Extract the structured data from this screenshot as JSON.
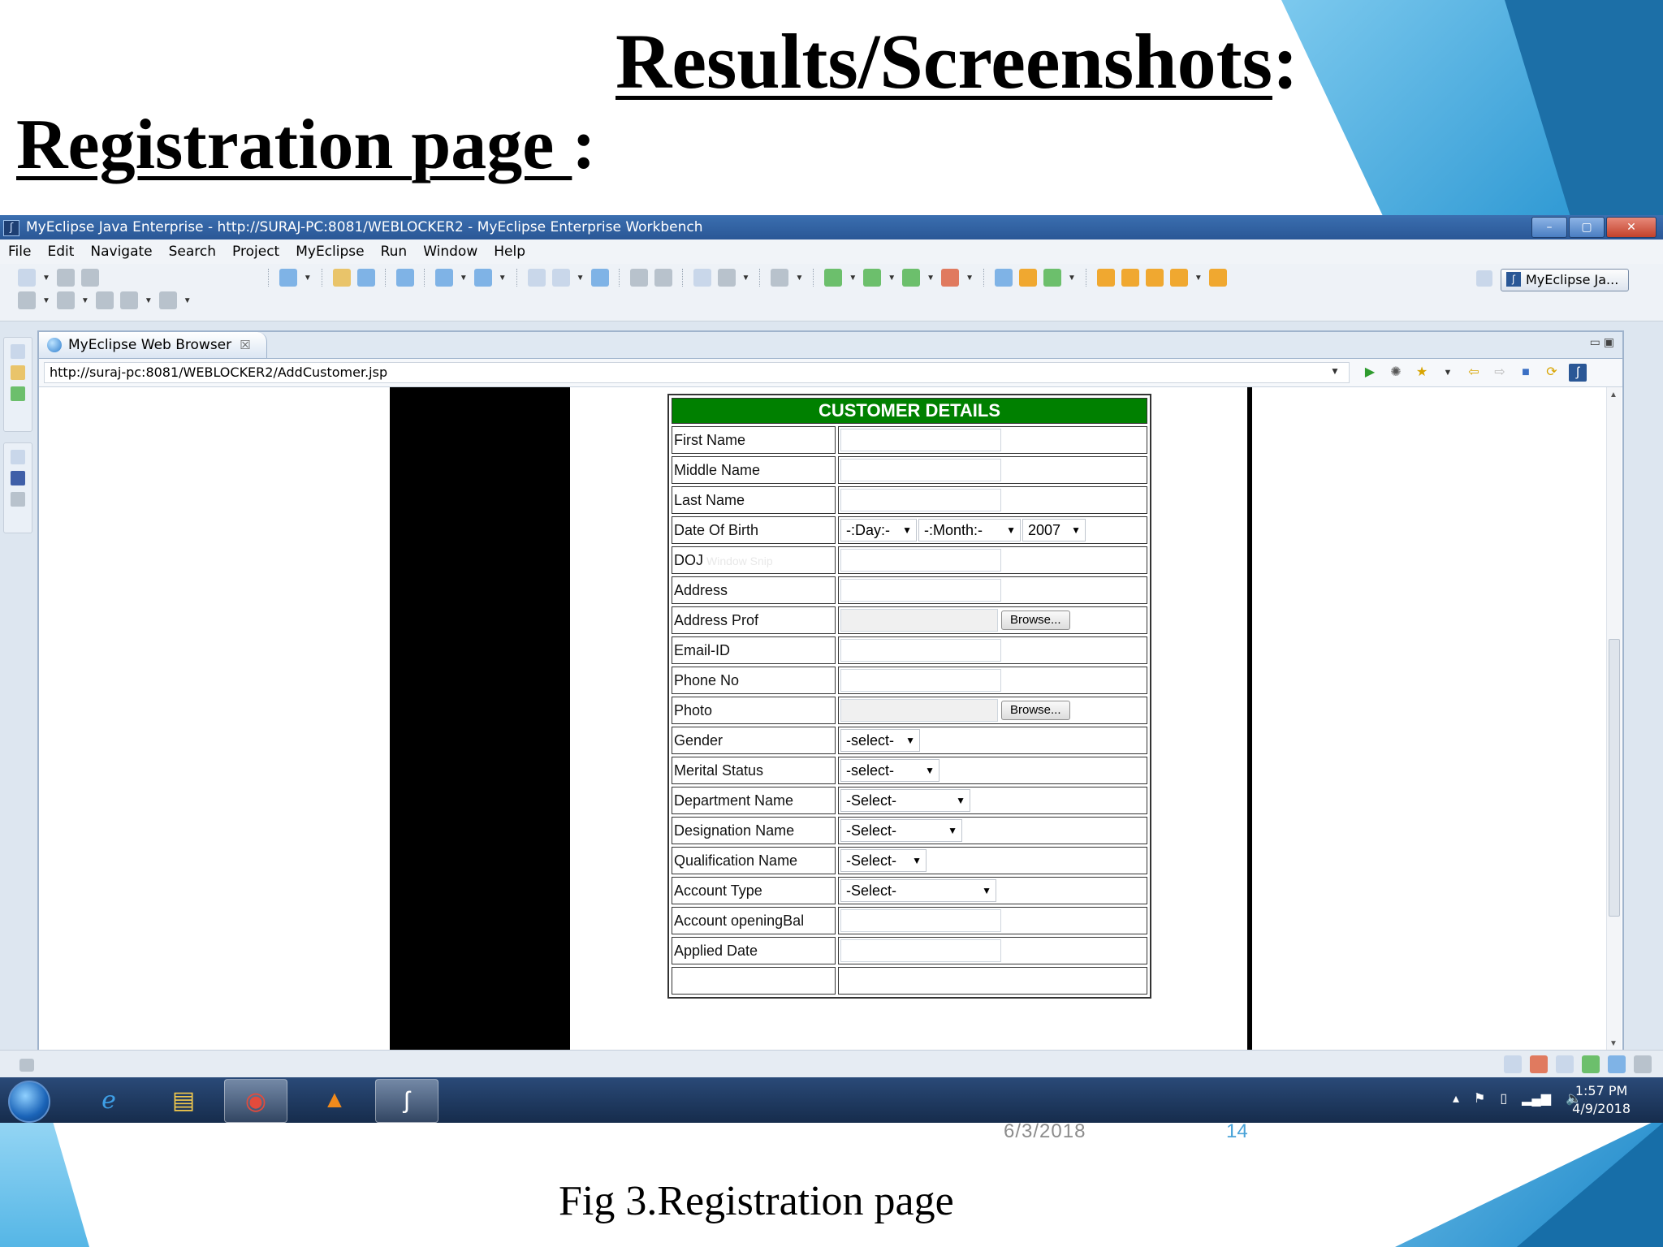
{
  "slide": {
    "title_main": "Results/Screenshots",
    "title_colon": ":",
    "subtitle_main": "Registration page ",
    "subtitle_colon": " :",
    "date": "6/3/2018",
    "page_number": "14",
    "caption": "Fig 3.Registration page"
  },
  "window": {
    "title": "MyEclipse Java Enterprise - http://SURAJ-PC:8081/WEBLOCKER2 - MyEclipse Enterprise Workbench",
    "minimize": "–",
    "maximize": "▢",
    "close": "✕"
  },
  "menu": [
    "File",
    "Edit",
    "Navigate",
    "Search",
    "Project",
    "MyEclipse",
    "Run",
    "Window",
    "Help"
  ],
  "perspective": {
    "label": "MyEclipse Ja..."
  },
  "editor_tab": {
    "label": "MyEclipse Web Browser",
    "close": "☒"
  },
  "browser": {
    "url": "http://suraj-pc:8081/WEBLOCKER2/AddCustomer.jsp"
  },
  "form": {
    "header": "CUSTOMER DETAILS",
    "labels": {
      "first_name": "First Name",
      "middle_name": "Middle Name",
      "last_name": "Last Name",
      "dob": "Date Of Birth",
      "doj": "DOJ",
      "address": "Address",
      "address_proof": "Address Prof",
      "email": "Email-ID",
      "phone": "Phone No",
      "photo": "Photo",
      "gender": "Gender",
      "marital": "Merital Status",
      "department": "Department Name",
      "designation": "Designation Name",
      "qualification": "Qualification Name",
      "account_type": "Account Type",
      "opening_bal": "Account openingBal",
      "applied_date": "Applied Date"
    },
    "dob": {
      "day": "-:Day:-",
      "month": "-:Month:-",
      "year": "2007"
    },
    "doj_ghost": "Window Snip",
    "browse": "Browse...",
    "selects": {
      "gender": "-select-",
      "marital": "-select-",
      "department": "-Select-",
      "designation": "-Select-",
      "qualification": "-Select-",
      "account_type": "-Select-"
    }
  },
  "clock": {
    "time": "1:57 PM",
    "date": "4/9/2018"
  },
  "colors": {
    "form_header": "#008000",
    "titlebar": "#2a5796",
    "taskbar": "#1b3457"
  }
}
